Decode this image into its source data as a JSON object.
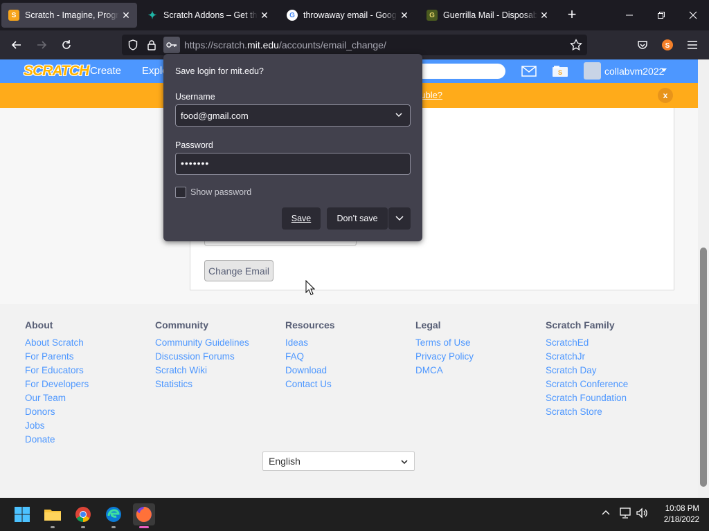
{
  "browser": {
    "tabs": [
      {
        "title": "Scratch - Imagine, Program, Share",
        "favicon": "scratch-cat-icon",
        "active": true
      },
      {
        "title": "Scratch Addons – Get this Extension",
        "favicon": "scratch-addons-icon",
        "active": false
      },
      {
        "title": "throwaway email - Google Search",
        "favicon": "google-icon",
        "active": false
      },
      {
        "title": "Guerrilla Mail - Disposable Temporary E-Mail Address",
        "favicon": "guerrilla-mail-icon",
        "active": false
      }
    ],
    "url_prefix": "https://scratch.",
    "url_domain": "mit.edu",
    "url_path": "/accounts/email_change/"
  },
  "scratch_nav": {
    "logo": "SCRATCH",
    "create": "Create",
    "explore": "Explore",
    "username": "collabvm2022"
  },
  "banner": {
    "link_text": "ouble?"
  },
  "form": {
    "change_email_button": "Change Email"
  },
  "popup": {
    "title": "Save login for mit.edu?",
    "username_label": "Username",
    "username_value": "food@gmail.com",
    "password_label": "Password",
    "password_value": "•••••••",
    "show_password": "Show password",
    "save": "Save",
    "dont_save": "Don’t save"
  },
  "footer": {
    "columns": [
      {
        "heading": "About",
        "links": [
          "About Scratch",
          "For Parents",
          "For Educators",
          "For Developers",
          "Our Team",
          "Donors",
          "Jobs",
          "Donate"
        ]
      },
      {
        "heading": "Community",
        "links": [
          "Community Guidelines",
          "Discussion Forums",
          "Scratch Wiki",
          "Statistics"
        ]
      },
      {
        "heading": "Resources",
        "links": [
          "Ideas",
          "FAQ",
          "Download",
          "Contact Us"
        ]
      },
      {
        "heading": "Legal",
        "links": [
          "Terms of Use",
          "Privacy Policy",
          "DMCA"
        ]
      },
      {
        "heading": "Scratch Family",
        "links": [
          "ScratchEd",
          "ScratchJr",
          "Scratch Day",
          "Scratch Conference",
          "Scratch Foundation",
          "Scratch Store"
        ]
      }
    ],
    "language": "English"
  },
  "taskbar": {
    "time": "10:08 PM",
    "date": "2/18/2022"
  },
  "colors": {
    "scratch_blue": "#4d97ff",
    "banner_orange": "#ffab1a",
    "popup_bg": "#42414d",
    "firefox_tab_bg": "#1c1b22"
  }
}
